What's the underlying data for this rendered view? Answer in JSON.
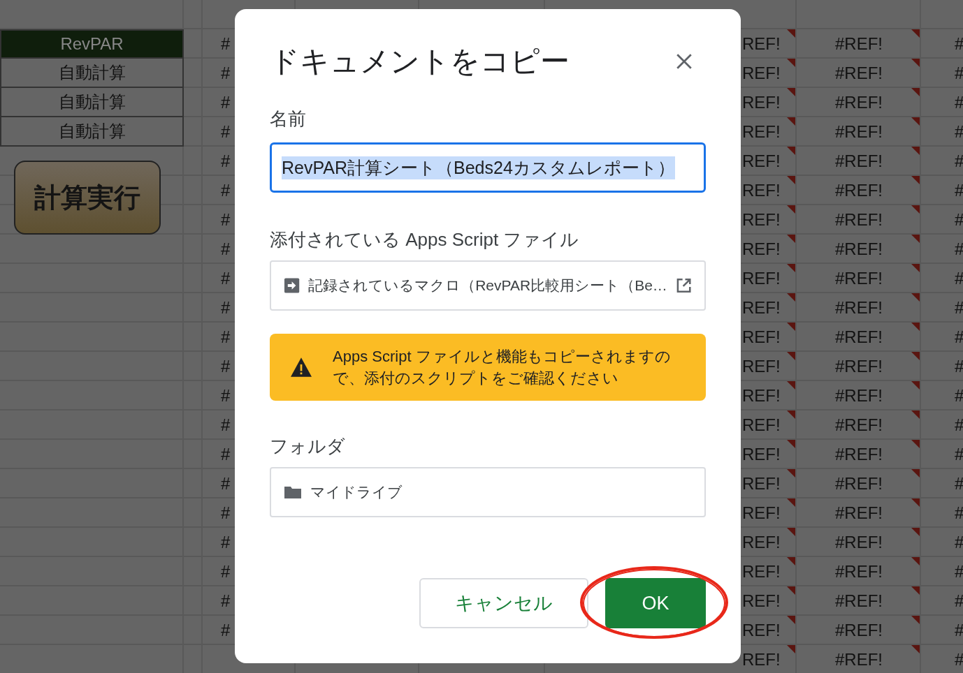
{
  "sheet": {
    "rows": [
      {
        "column_1": "RevPAR",
        "kind": "header",
        "column_3": "#",
        "column_7": "REF!",
        "column_8": "#REF!",
        "column_9": "#",
        "flagged": true
      },
      {
        "column_1": "自動計算",
        "kind": "boxed",
        "column_3": "#",
        "column_7": "REF!",
        "column_8": "#REF!",
        "column_9": "#",
        "flagged": true
      },
      {
        "column_1": "自動計算",
        "kind": "boxed",
        "column_3": "#",
        "column_7": "REF!",
        "column_8": "#REF!",
        "column_9": "#",
        "flagged": true
      },
      {
        "column_1": "自動計算",
        "kind": "boxed",
        "column_3": "#",
        "column_7": "REF!",
        "column_8": "#REF!",
        "column_9": "#",
        "flagged": true
      },
      {
        "column_3": "#",
        "column_7": "REF!",
        "column_8": "#REF!",
        "column_9": "#",
        "flagged": true
      },
      {
        "column_3": "#",
        "column_7": "REF!",
        "column_8": "#REF!",
        "column_9": "#",
        "flagged": true
      },
      {
        "column_3": "#",
        "column_7": "REF!",
        "column_8": "#REF!",
        "column_9": "#",
        "flagged": true
      },
      {
        "column_3": "#",
        "column_7": "REF!",
        "column_8": "#REF!",
        "column_9": "#",
        "flagged": true
      },
      {
        "column_3": "#",
        "column_7": "REF!",
        "column_8": "#REF!",
        "column_9": "#",
        "flagged": true
      },
      {
        "column_3": "#",
        "column_7": "REF!",
        "column_8": "#REF!",
        "column_9": "#",
        "flagged": true
      },
      {
        "column_3": "#",
        "column_7": "REF!",
        "column_8": "#REF!",
        "column_9": "#",
        "flagged": true
      },
      {
        "column_3": "#",
        "column_7": "REF!",
        "column_8": "#REF!",
        "column_9": "#",
        "flagged": true
      },
      {
        "column_3": "#",
        "column_7": "REF!",
        "column_8": "#REF!",
        "column_9": "#",
        "flagged": true
      },
      {
        "column_3": "#",
        "column_7": "REF!",
        "column_8": "#REF!",
        "column_9": "#",
        "flagged": true
      },
      {
        "column_3": "#",
        "column_7": "REF!",
        "column_8": "#REF!",
        "column_9": "#",
        "flagged": true
      },
      {
        "column_3": "#",
        "column_7": "REF!",
        "column_8": "#REF!",
        "column_9": "#",
        "flagged": true
      },
      {
        "column_3": "#",
        "column_7": "REF!",
        "column_8": "#REF!",
        "column_9": "#",
        "flagged": true
      },
      {
        "column_3": "#",
        "column_7": "REF!",
        "column_8": "#REF!",
        "column_9": "#",
        "flagged": true
      },
      {
        "column_3": "#",
        "column_7": "REF!",
        "column_8": "#REF!",
        "column_9": "#",
        "flagged": true
      },
      {
        "column_3": "#",
        "column_7": "REF!",
        "column_8": "#REF!",
        "column_9": "#",
        "flagged": true
      },
      {
        "column_3": "#",
        "column_7": "REF!",
        "column_8": "#REF!",
        "column_9": "#",
        "flagged": true
      },
      {
        "column_7": "REF!",
        "column_8": "#REF!",
        "column_9": "#",
        "flagged": true
      }
    ],
    "macro_button": "計算実行"
  },
  "dialog": {
    "title": "ドキュメントをコピー",
    "name_label": "名前",
    "name_value": "RevPAR計算シート（Beds24カスタムレポート）",
    "script_label": "添付されている Apps Script ファイル",
    "script_file": "記録されているマクロ（RevPAR比較用シート（Be…",
    "warning": "Apps Script ファイルと機能もコピーされますので、添付のスクリプトをご確認ください",
    "folder_label": "フォルダ",
    "folder": "マイドライブ",
    "buttons": [
      {
        "label": "キャンセル",
        "kind": "secondary"
      },
      {
        "label": "OK",
        "kind": "primary"
      }
    ]
  }
}
